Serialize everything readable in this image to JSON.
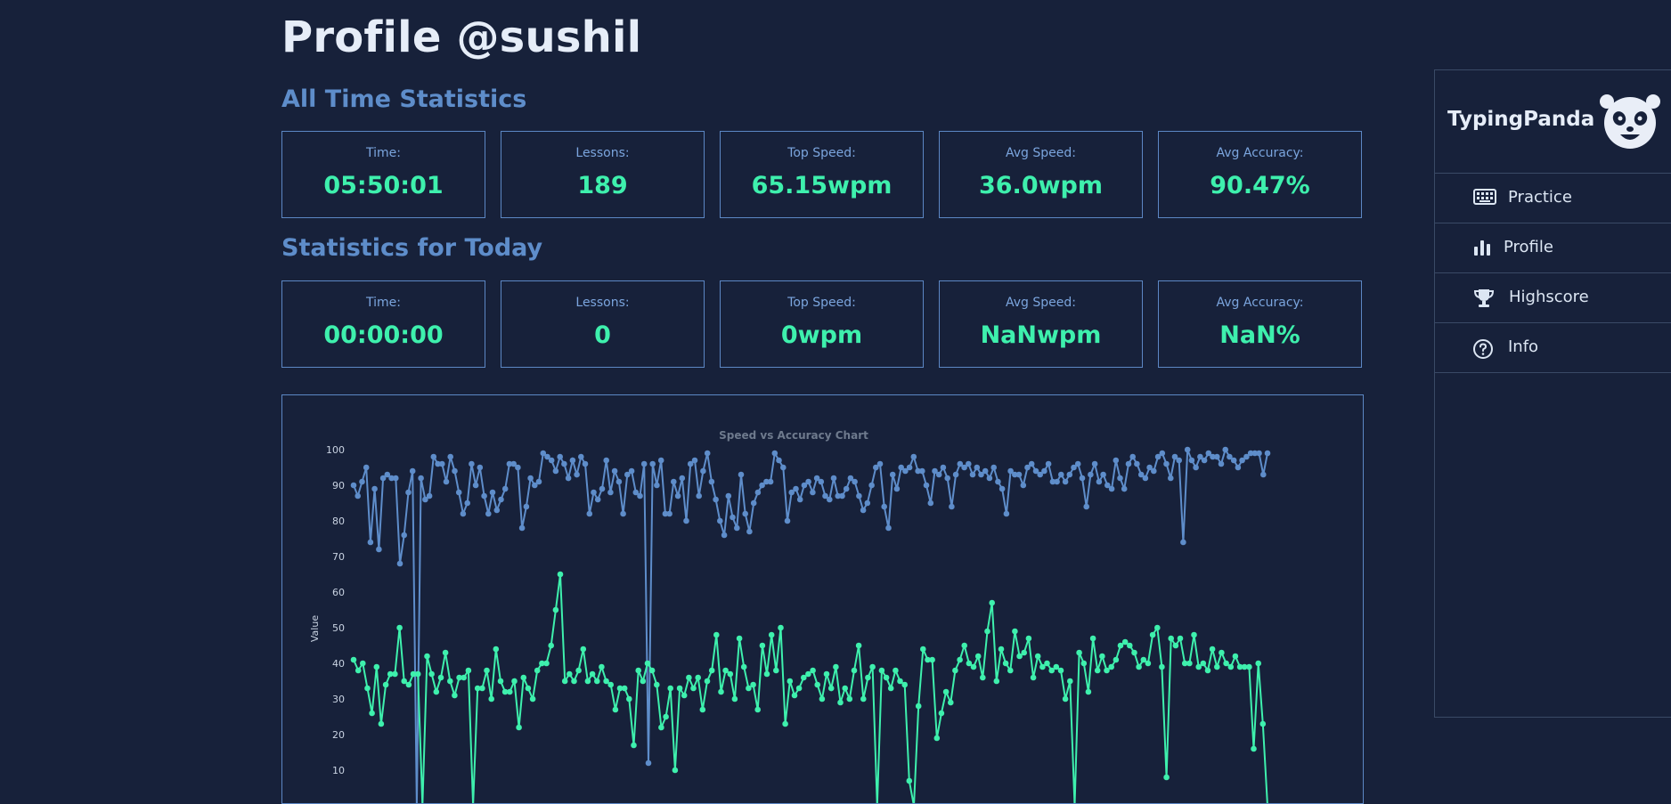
{
  "page": {
    "title": "Profile @sushil",
    "alltime_heading": "All Time Statistics",
    "today_heading": "Statistics for Today"
  },
  "alltime_stats": [
    {
      "label": "Time:",
      "value": "05:50:01"
    },
    {
      "label": "Lessons:",
      "value": "189"
    },
    {
      "label": "Top Speed:",
      "value": "65.15wpm"
    },
    {
      "label": "Avg Speed:",
      "value": "36.0wpm"
    },
    {
      "label": "Avg Accuracy:",
      "value": "90.47%"
    }
  ],
  "today_stats": [
    {
      "label": "Time:",
      "value": "00:00:00"
    },
    {
      "label": "Lessons:",
      "value": "0"
    },
    {
      "label": "Top Speed:",
      "value": "0wpm"
    },
    {
      "label": "Avg Speed:",
      "value": "NaNwpm"
    },
    {
      "label": "Avg Accuracy:",
      "value": "NaN%"
    }
  ],
  "sidebar": {
    "brand": "TypingPanda",
    "logo_icon": "panda-logo-icon",
    "items": [
      {
        "label": "Practice",
        "icon": "keyboard-icon"
      },
      {
        "label": "Profile",
        "icon": "bar-chart-icon"
      },
      {
        "label": "Highscore",
        "icon": "trophy-icon"
      },
      {
        "label": "Info",
        "icon": "question-circle-icon"
      }
    ]
  },
  "colors": {
    "background": "#17213a",
    "accent_green": "#3ef0ad",
    "accent_blue": "#5e8dca",
    "border": "#5c87c4"
  },
  "chart_data": {
    "type": "line",
    "title": "Speed vs Accuracy Chart",
    "ylabel": "Value",
    "xlabel": "",
    "ylim": [
      0,
      100
    ],
    "y_ticks": [
      10,
      20,
      30,
      40,
      50,
      60,
      70,
      80,
      90,
      100
    ],
    "grid": false,
    "series": [
      {
        "color": "#5e8dca",
        "values": [
          90,
          87,
          91,
          95,
          74,
          89,
          72,
          92,
          93,
          92,
          92,
          68,
          76,
          88,
          94,
          0,
          92,
          86,
          87,
          98,
          96,
          96,
          91,
          98,
          94,
          88,
          82,
          85,
          96,
          90,
          95,
          87,
          82,
          88,
          83,
          86,
          89,
          96,
          96,
          95,
          78,
          84,
          92,
          90,
          91,
          99,
          98,
          97,
          94,
          98,
          96,
          92,
          97,
          93,
          98,
          96,
          82,
          88,
          86,
          89,
          97,
          88,
          94,
          91,
          82,
          93,
          94,
          88,
          87,
          96,
          12,
          96,
          90,
          97,
          82,
          82,
          91,
          87,
          92,
          80,
          96,
          97,
          87,
          94,
          99,
          91,
          86,
          80,
          76,
          87,
          81,
          78,
          93,
          82,
          77,
          85,
          88,
          90,
          91,
          91,
          99,
          97,
          95,
          80,
          88,
          89,
          86,
          90,
          91,
          88,
          92,
          91,
          87,
          86,
          92,
          87,
          87,
          89,
          92,
          91,
          87,
          83,
          85,
          90,
          95,
          96,
          84,
          78,
          93,
          89,
          95,
          94,
          95,
          98,
          94,
          94,
          90,
          85,
          94,
          93,
          95,
          92,
          84,
          93,
          96,
          95,
          96,
          93,
          95,
          93,
          94,
          92,
          95,
          91,
          89,
          82,
          94,
          93,
          93,
          90,
          95,
          96,
          94,
          93,
          94,
          96,
          91,
          91,
          93,
          91,
          93,
          95,
          96,
          92,
          84,
          93,
          96,
          91,
          93,
          90,
          89,
          97,
          92,
          89,
          96,
          98,
          96,
          93,
          92,
          95,
          94,
          98,
          99,
          96,
          92,
          98,
          97,
          74,
          100,
          97,
          95,
          98,
          97,
          99,
          98,
          98,
          96,
          100,
          98,
          97,
          95,
          97,
          98,
          99,
          99,
          99,
          93,
          99
        ],
        "values_note": ""
      },
      {
        "color": "#3ef0ad",
        "values": [
          41,
          38,
          40,
          33,
          26,
          39,
          23,
          34,
          37,
          37,
          50,
          35,
          34,
          37,
          37,
          0,
          42,
          37,
          32,
          36,
          43,
          35,
          31,
          36,
          36,
          38,
          0,
          33,
          33,
          38,
          30,
          44,
          35,
          32,
          32,
          35,
          22,
          36,
          33,
          30,
          38,
          40,
          40,
          45,
          55,
          65,
          35,
          37,
          35,
          38,
          44,
          35,
          37,
          35,
          39,
          35,
          34,
          27,
          33,
          33,
          30,
          17,
          38,
          35,
          40,
          38,
          34,
          22,
          25,
          33,
          10,
          33,
          31,
          36,
          33,
          36,
          27,
          35,
          38,
          48,
          32,
          38,
          37,
          30,
          47,
          39,
          33,
          34,
          27,
          45,
          37,
          48,
          38,
          50,
          23,
          35,
          31,
          33,
          36,
          37,
          38,
          34,
          30,
          37,
          33,
          39,
          29,
          33,
          30,
          38,
          45,
          30,
          36,
          39,
          0,
          38,
          36,
          33,
          38,
          35,
          34,
          7,
          0,
          28,
          44,
          41,
          41,
          19,
          26,
          32,
          29,
          38,
          41,
          45,
          40,
          39,
          42,
          36,
          49,
          57,
          35,
          44,
          40,
          38,
          49,
          42,
          43,
          47,
          36,
          42,
          39,
          40,
          38,
          39,
          38,
          30,
          35,
          0,
          43,
          40,
          32,
          47,
          38,
          42,
          38,
          39,
          41,
          45,
          46,
          45,
          43,
          39,
          41,
          40,
          48,
          50,
          39,
          8,
          47,
          45,
          47,
          40,
          40,
          48,
          39,
          40,
          38,
          44,
          39,
          43,
          40,
          39,
          42,
          39,
          39,
          39,
          16,
          40,
          23,
          0
        ]
      }
    ]
  }
}
